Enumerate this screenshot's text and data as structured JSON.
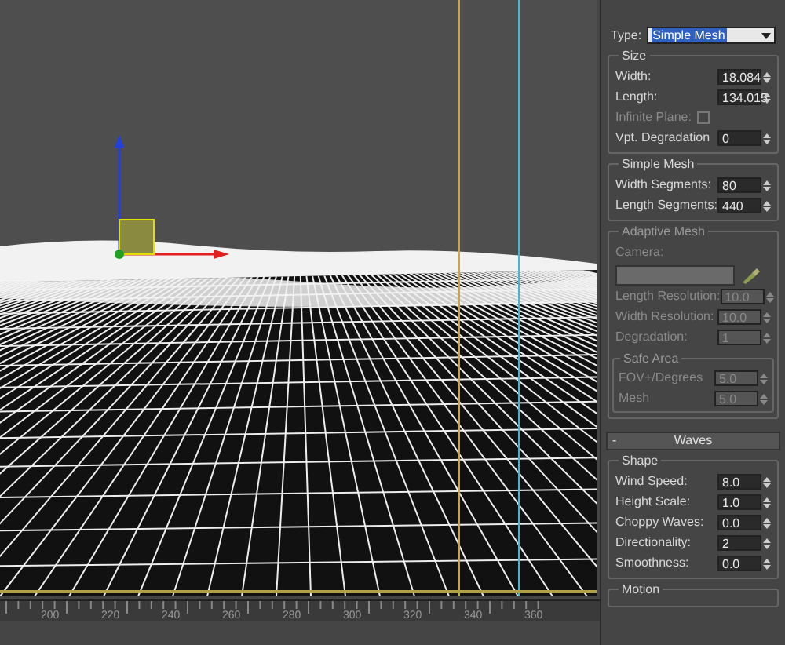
{
  "type_dropdown": {
    "label": "Type:",
    "value": "Simple Mesh"
  },
  "groups": [
    {
      "title": "Size",
      "disabled": false,
      "rows": [
        {
          "kind": "spinner",
          "label": "Width:",
          "value": "18.084"
        },
        {
          "kind": "spinner",
          "label": "Length:",
          "value": "134.015"
        },
        {
          "kind": "checkbox",
          "label": "Infinite Plane:",
          "checked": false,
          "disabled": true
        },
        {
          "kind": "spinner",
          "label": "Vpt. Degradation",
          "value": "0"
        }
      ]
    },
    {
      "title": "Simple Mesh",
      "disabled": false,
      "rows": [
        {
          "kind": "spinner",
          "label": "Width Segments:",
          "value": "80"
        },
        {
          "kind": "spinner",
          "label": "Length Segments:",
          "value": "440"
        }
      ]
    },
    {
      "title": "Adaptive Mesh",
      "disabled": true,
      "rows": [
        {
          "kind": "camera",
          "label": "Camera:"
        },
        {
          "kind": "spinner",
          "label": "Length Resolution:",
          "value": "10.0"
        },
        {
          "kind": "spinner",
          "label": "Width Resolution:",
          "value": "10.0"
        },
        {
          "kind": "spinner",
          "label": "Degradation:",
          "value": "1"
        }
      ],
      "subgroup": {
        "title": "Safe Area",
        "rows": [
          {
            "kind": "spinner",
            "label": "FOV+/Degrees",
            "value": "5.0"
          },
          {
            "kind": "spinner",
            "label": "Mesh",
            "value": "5.0"
          }
        ]
      }
    }
  ],
  "rollout": {
    "sign": "-",
    "title": "Waves",
    "groups": [
      {
        "title": "Shape",
        "disabled": false,
        "rows": [
          {
            "kind": "spinner",
            "label": "Wind Speed:",
            "value": "8.0"
          },
          {
            "kind": "spinner",
            "label": "Height Scale:",
            "value": "1.0"
          },
          {
            "kind": "spinner",
            "label": "Choppy Waves:",
            "value": "0.0"
          },
          {
            "kind": "spinner",
            "label": "Directionality:",
            "value": "2"
          },
          {
            "kind": "spinner",
            "label": "Smoothness:",
            "value": "0.0"
          }
        ]
      },
      {
        "title": "Motion",
        "disabled": false
      }
    ]
  },
  "ruler": {
    "labels": [
      "200",
      "220",
      "240",
      "260",
      "280",
      "300",
      "320",
      "340",
      "360"
    ]
  }
}
